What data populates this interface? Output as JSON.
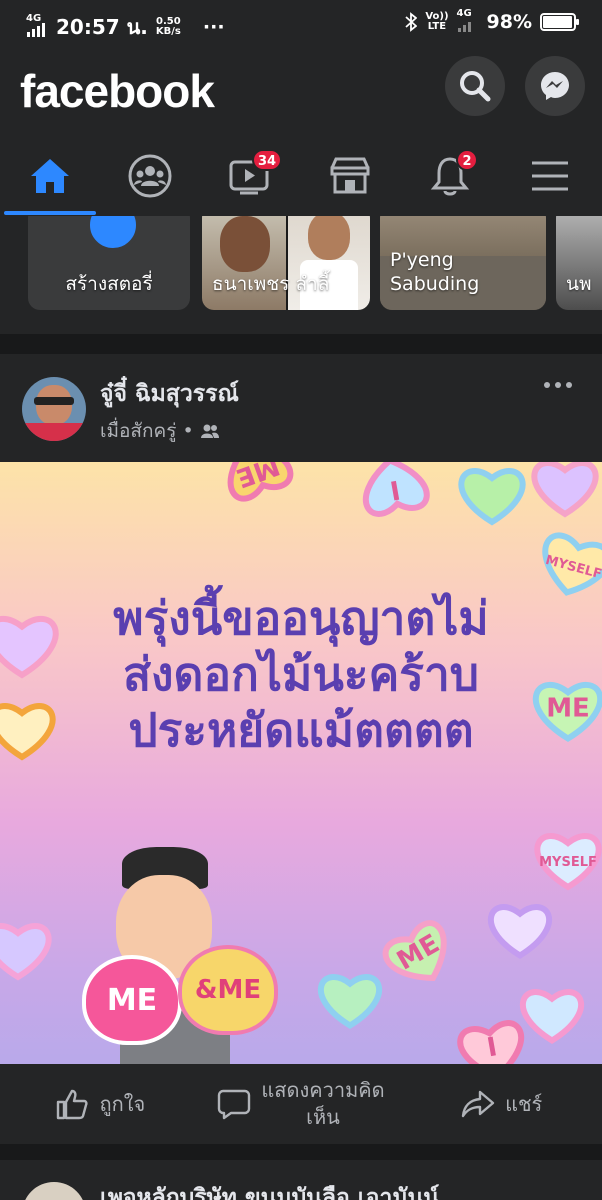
{
  "statusbar": {
    "network_type": "4G",
    "time": "20:57 น.",
    "speed_value": "0.50",
    "speed_unit": "KB/s",
    "overflow": "···",
    "lte_top": "Vo))",
    "lte_bottom": "LTE",
    "network_type2": "4G",
    "battery_percent": "98%",
    "battery_level": 0.98
  },
  "header": {
    "logo": "facebook"
  },
  "tabs": {
    "watch_badge": "34",
    "notifications_badge": "2"
  },
  "stories": [
    {
      "label": "สร้างสตอรี่"
    },
    {
      "label": "ธนาเพชร ลำลี้"
    },
    {
      "label": "P'yeng Sabuding"
    },
    {
      "label": "นพ"
    }
  ],
  "post": {
    "author": "จู๋จี๋ ฉิมสุวรรณ์",
    "time": "เมื่อสักครู่",
    "dot": "•",
    "image_text_lines": [
      "พรุ่งนี้ขออนุญาตไม่",
      "ส่งดอกไม้นะคร้าบ",
      "ประหยัดแม้ตตตต"
    ],
    "heart_texts": [
      "ME",
      "I",
      "MYSELF",
      "ME",
      "MYSELF",
      "ME",
      "I",
      "ME",
      "&ME"
    ],
    "actions": {
      "like": "ถูกใจ",
      "comment_line1": "แสดงความคิด",
      "comment_line2": "เห็น",
      "share": "แชร์"
    }
  },
  "next_post": {
    "author": "เพจหลักบริษัท ขนมบันลือ เอามันน์"
  }
}
